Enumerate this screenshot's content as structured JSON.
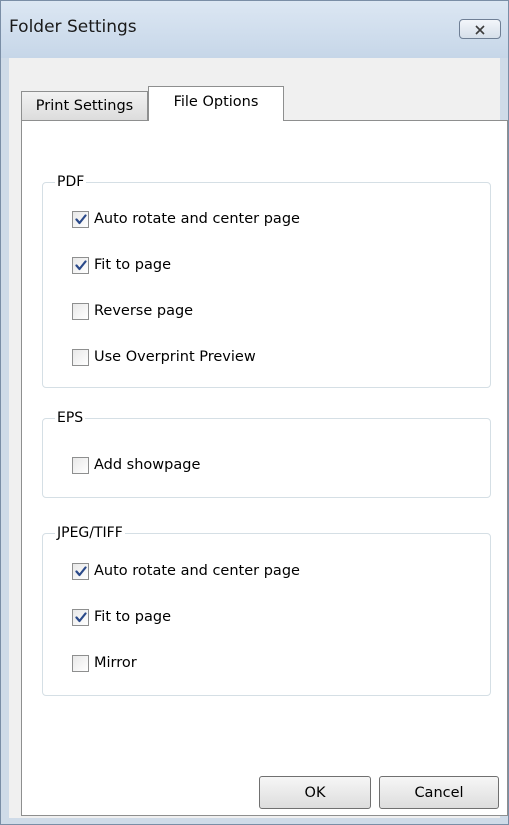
{
  "window": {
    "title": "Folder Settings"
  },
  "tabs": [
    {
      "label": "Print Settings",
      "selected": false
    },
    {
      "label": "File Options",
      "selected": true
    }
  ],
  "groups": {
    "pdf": {
      "title": "PDF",
      "options": [
        {
          "label": "Auto rotate and center page",
          "checked": true
        },
        {
          "label": "Fit to page",
          "checked": true
        },
        {
          "label": "Reverse page",
          "checked": false
        },
        {
          "label": "Use Overprint Preview",
          "checked": false
        }
      ]
    },
    "eps": {
      "title": "EPS",
      "options": [
        {
          "label": "Add showpage",
          "checked": false
        }
      ]
    },
    "jpeg_tiff": {
      "title": "JPEG/TIFF",
      "options": [
        {
          "label": "Auto rotate and center page",
          "checked": true
        },
        {
          "label": "Fit to page",
          "checked": true
        },
        {
          "label": "Mirror",
          "checked": false
        }
      ]
    }
  },
  "buttons": {
    "ok": "OK",
    "cancel": "Cancel"
  },
  "colors": {
    "check": "#2b4a8a",
    "frame": "#cfdbe8"
  }
}
